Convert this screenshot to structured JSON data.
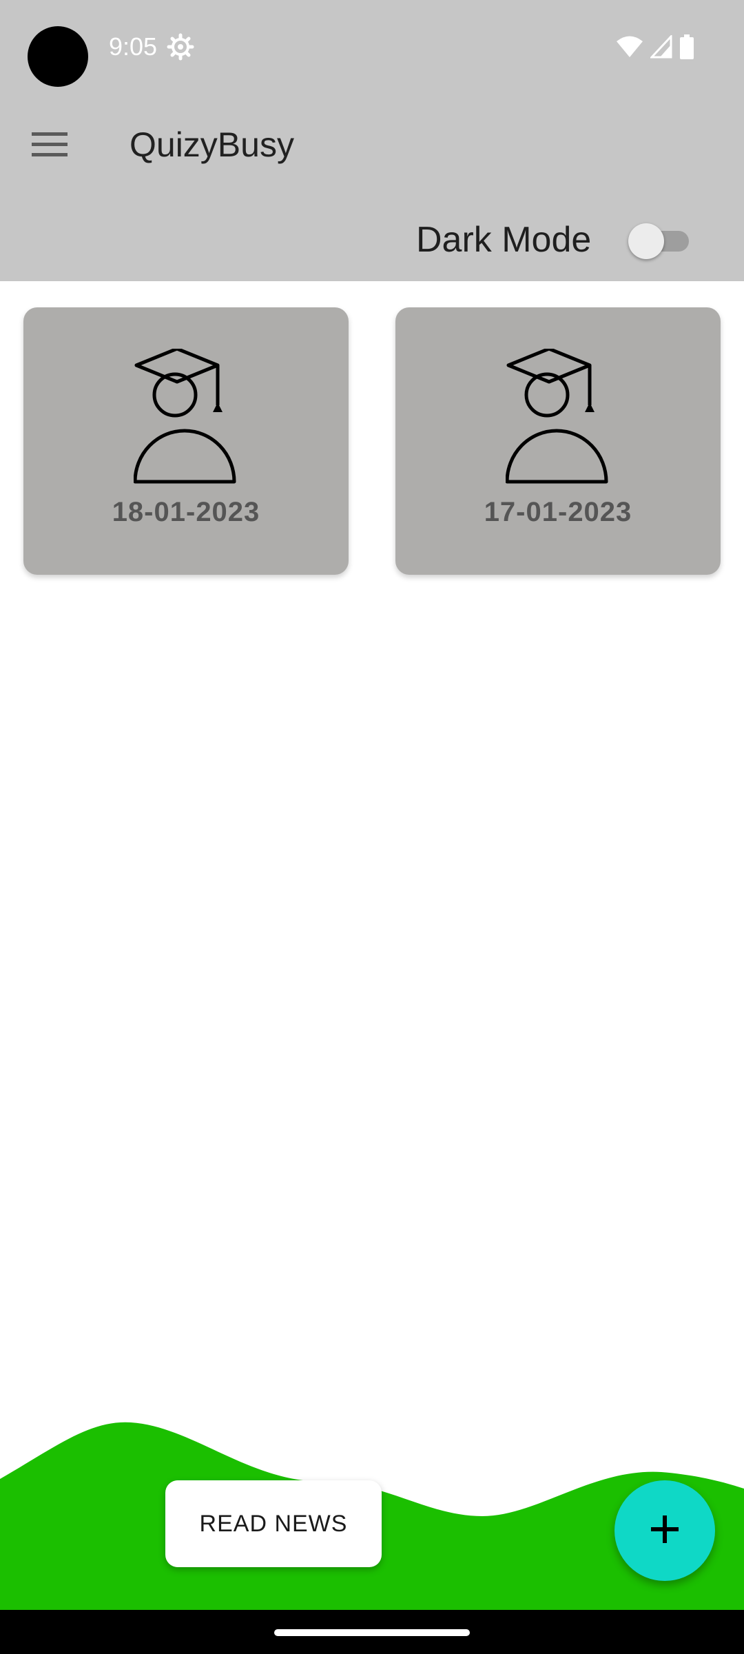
{
  "status_bar": {
    "time": "9:05",
    "icons": [
      "settings-icon",
      "wifi-icon",
      "cell-signal-icon",
      "battery-icon"
    ]
  },
  "app_bar": {
    "title": "QuizyBusy",
    "menu_icon": "hamburger-menu-icon"
  },
  "dark_mode": {
    "label": "Dark Mode",
    "enabled": false
  },
  "cards": [
    {
      "date": "18-01-2023",
      "icon": "student-graduate-icon"
    },
    {
      "date": "17-01-2023",
      "icon": "student-graduate-icon"
    }
  ],
  "bottom": {
    "read_news_label": "READ NEWS",
    "fab_icon": "plus-icon"
  },
  "colors": {
    "header_bg": "#c6c6c6",
    "card_bg": "#aeadab",
    "wave_green": "#1bbf00",
    "fab_teal": "#0fd8c6"
  }
}
